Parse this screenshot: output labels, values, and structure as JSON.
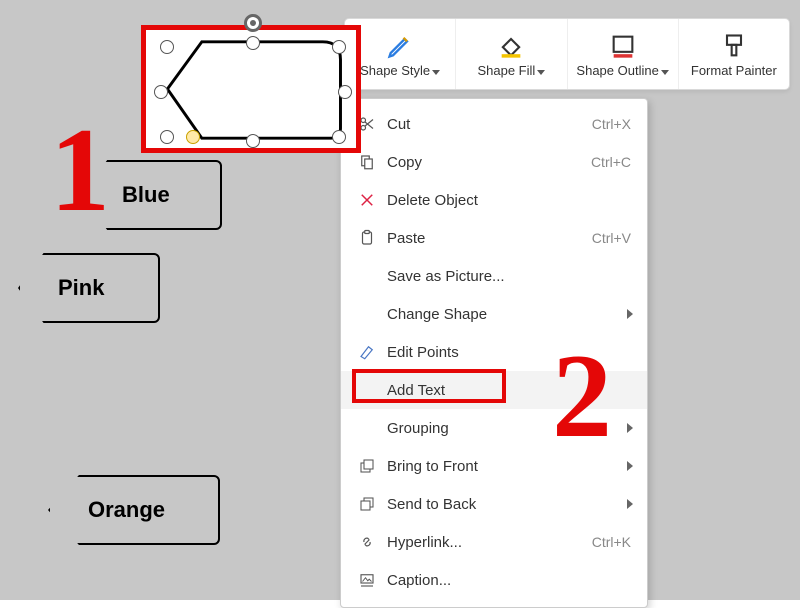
{
  "toolbar": {
    "shapeStyle": "Shape Style",
    "shapeFill": "Shape Fill",
    "shapeOutline": "Shape Outline",
    "formatPainter": "Format Painter"
  },
  "contextMenu": {
    "items": [
      {
        "label": "Cut",
        "shortcut": "Ctrl+X"
      },
      {
        "label": "Copy",
        "shortcut": "Ctrl+C"
      },
      {
        "label": "Delete Object",
        "shortcut": ""
      },
      {
        "label": "Paste",
        "shortcut": "Ctrl+V"
      },
      {
        "label": "Save as Picture...",
        "shortcut": ""
      },
      {
        "label": "Change Shape",
        "shortcut": ""
      },
      {
        "label": "Edit Points",
        "shortcut": ""
      },
      {
        "label": "Add Text",
        "shortcut": ""
      },
      {
        "label": "Grouping",
        "shortcut": ""
      },
      {
        "label": "Bring to Front",
        "shortcut": ""
      },
      {
        "label": "Send to Back",
        "shortcut": ""
      },
      {
        "label": "Hyperlink...",
        "shortcut": "Ctrl+K"
      },
      {
        "label": "Caption...",
        "shortcut": ""
      }
    ]
  },
  "shapes": {
    "blue": "Blue",
    "pink": "Pink",
    "orange": "Orange"
  },
  "annotations": {
    "num1": "1",
    "num2": "2"
  }
}
